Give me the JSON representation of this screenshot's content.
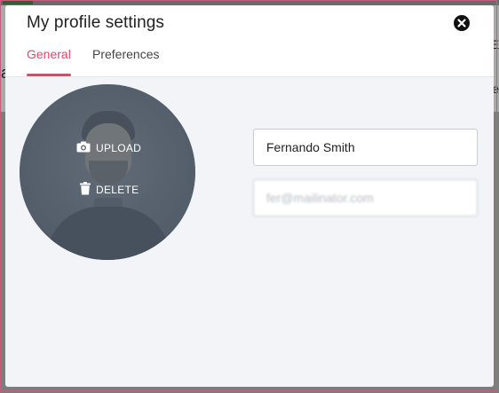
{
  "background": {
    "left_text": "a",
    "right_text_1": "E",
    "right_text_2": "re"
  },
  "modal": {
    "title": "My profile settings",
    "tabs": [
      {
        "label": "General",
        "active": true
      },
      {
        "label": "Preferences",
        "active": false
      }
    ],
    "accent_color": "#e8436a"
  },
  "avatar": {
    "upload_label": "UPLOAD",
    "delete_label": "DELETE",
    "upload_icon": "camera-icon",
    "delete_icon": "trash-icon"
  },
  "form": {
    "name_value": "Fernando Smith",
    "email_value": "fer@mailinator.com"
  }
}
